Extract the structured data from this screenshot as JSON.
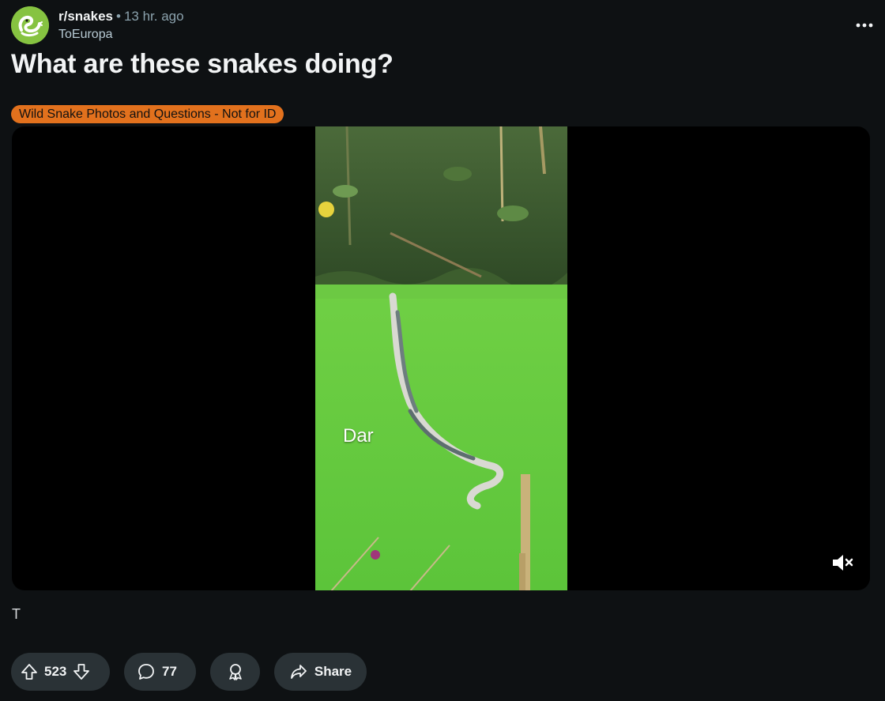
{
  "post": {
    "subreddit": "r/snakes",
    "separator": "•",
    "time": "13 hr. ago",
    "author": "ToEuropa",
    "title": "What are these snakes doing?",
    "flair": "Wild Snake Photos and Questions - Not for ID",
    "body": "T"
  },
  "media": {
    "caption": "Dar",
    "muted": true
  },
  "actions": {
    "score": "523",
    "comments": "77",
    "share_label": "Share"
  },
  "colors": {
    "background": "#0e1113",
    "flair": "#e2711d",
    "avatar": "#86c341",
    "pill": "#2a3236"
  },
  "icons": {
    "avatar": "snake-logo-icon",
    "more": "more-options-icon",
    "mute": "speaker-muted-icon",
    "upvote": "upvote-arrow-icon",
    "downvote": "downvote-arrow-icon",
    "comment": "comment-bubble-icon",
    "award": "award-icon",
    "share": "share-arrow-icon"
  }
}
